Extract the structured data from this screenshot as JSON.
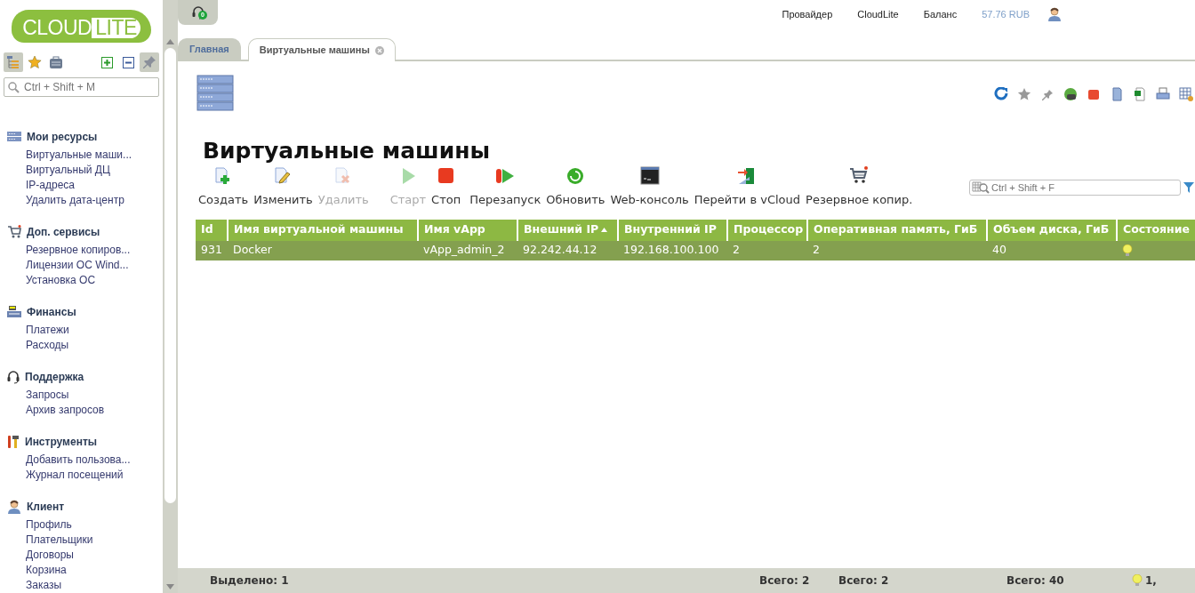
{
  "header": {
    "notifications": "0",
    "provider_label": "Провайдер",
    "provider_value": "CloudLite",
    "balance_label": "Баланс",
    "balance_value": "57.76 RUB"
  },
  "logo": {
    "part1": "CLOUD",
    "part2": "LITE"
  },
  "tabs": [
    {
      "label": "Главная",
      "selected": false,
      "closable": false
    },
    {
      "label": "Виртуальные машины",
      "selected": true,
      "closable": true
    }
  ],
  "sidebar": {
    "tools": [
      {
        "selected": true
      },
      {
        "selected": false
      },
      {
        "selected": false
      },
      {
        "selected": false
      },
      {
        "selected": false
      },
      {
        "selected": true
      }
    ],
    "search": {
      "placeholder": "Ctrl + Shift + M"
    },
    "sections": [
      {
        "title": "Мои ресурсы",
        "items": [
          "Виртуальные маши...",
          "Виртуальный ДЦ",
          "IP-адреса",
          "Удалить дата-центр"
        ]
      },
      {
        "title": "Доп. сервисы",
        "items": [
          "Резервное копиров...",
          "Лицензии ОС Wind...",
          "Установка ОС"
        ]
      },
      {
        "title": "Финансы",
        "items": [
          "Платежи",
          "Расходы"
        ]
      },
      {
        "title": "Поддержка",
        "items": [
          "Запросы",
          "Архив запросов"
        ]
      },
      {
        "title": "Инструменты",
        "items": [
          "Добавить пользова...",
          "Журнал посещений"
        ]
      },
      {
        "title": "Клиент",
        "items": [
          "Профиль",
          "Плательщики",
          "Договоры",
          "Корзина",
          "Заказы"
        ]
      }
    ]
  },
  "page_title": "Виртуальные машины",
  "toolbar": [
    {
      "label": "Создать",
      "disabled": false
    },
    {
      "label": "Изменить",
      "disabled": false
    },
    {
      "label": "Удалить",
      "disabled": true
    },
    {
      "label": "Старт",
      "disabled": true
    },
    {
      "label": "Стоп",
      "disabled": false
    },
    {
      "label": "Перезапуск",
      "disabled": false
    },
    {
      "label": "Обновить",
      "disabled": false
    },
    {
      "label": "Web-консоль",
      "disabled": false
    },
    {
      "label": "Перейти в vCloud",
      "disabled": false
    },
    {
      "label": "Резервное копир.",
      "disabled": false
    }
  ],
  "filter": {
    "placeholder": "Ctrl + Shift + F"
  },
  "table": {
    "columns": [
      {
        "label": "Id",
        "sorted": false
      },
      {
        "label": "Имя виртуальной машины",
        "sorted": false
      },
      {
        "label": "Имя vApp",
        "sorted": false
      },
      {
        "label": "Внешний IP",
        "sorted": true
      },
      {
        "label": "Внутренний IP",
        "sorted": false
      },
      {
        "label": "Процессор",
        "sorted": false
      },
      {
        "label": "Оперативная память, ГиБ",
        "sorted": false
      },
      {
        "label": "Объем диска, ГиБ",
        "sorted": false
      },
      {
        "label": "Состояние",
        "sorted": false
      }
    ],
    "rows": [
      {
        "selected": true,
        "running": true,
        "cells": [
          "931",
          "Docker",
          "vApp_admin_2",
          "92.242.44.12",
          "192.168.100.100",
          "2",
          "2",
          "40"
        ]
      }
    ],
    "footer": {
      "selected_count": "Выделено: 1",
      "cpu_total": "Всего: 2",
      "ram_total": "Всего: 2",
      "disk_total": "Всего: 40",
      "state_total": "1,"
    }
  }
}
